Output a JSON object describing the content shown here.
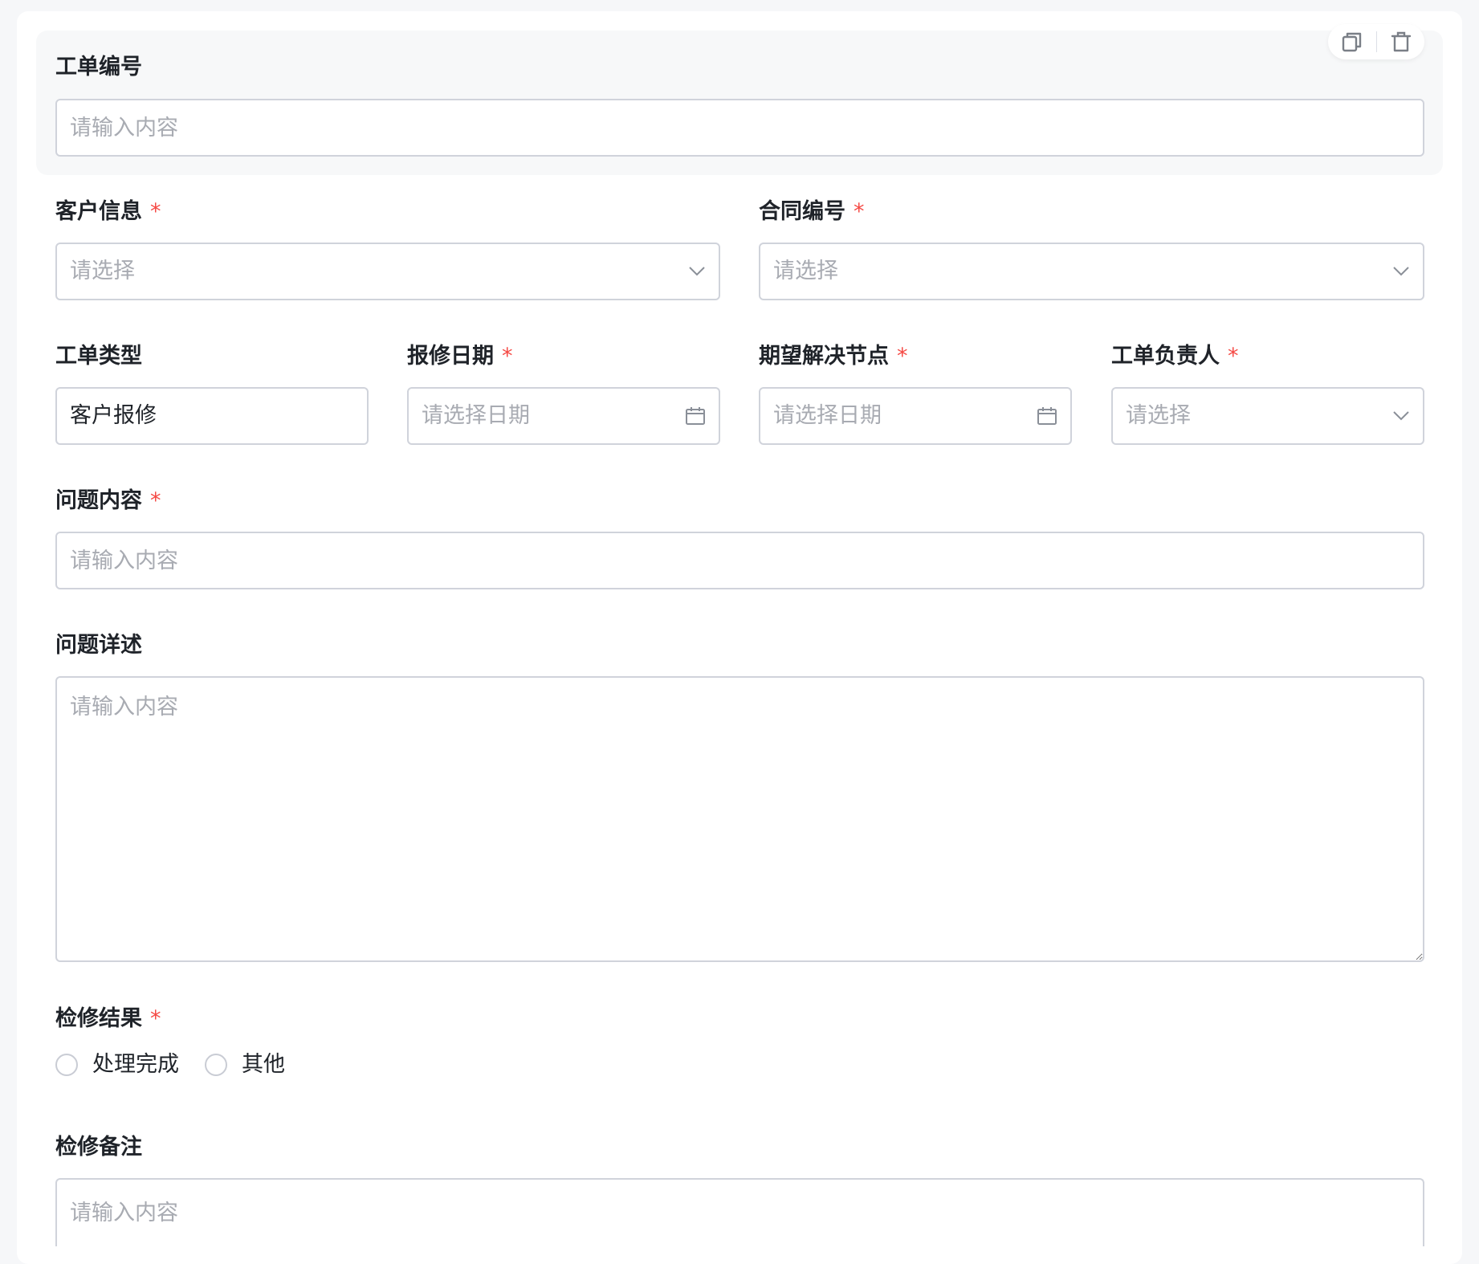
{
  "form": {
    "work_order_no": {
      "label": "工单编号",
      "placeholder": "请输入内容"
    },
    "customer_info": {
      "label": "客户信息",
      "required_mark": "*",
      "placeholder": "请选择",
      "icon": "chevron-down-icon"
    },
    "contract_no": {
      "label": "合同编号",
      "required_mark": "*",
      "placeholder": "请选择",
      "icon": "chevron-down-icon"
    },
    "work_order_type": {
      "label": "工单类型",
      "value": "客户报修"
    },
    "report_date": {
      "label": "报修日期",
      "required_mark": "*",
      "placeholder": "请选择日期",
      "icon": "calendar-icon"
    },
    "expected_resolution": {
      "label": "期望解决节点",
      "required_mark": "*",
      "placeholder": "请选择日期",
      "icon": "calendar-icon"
    },
    "owner": {
      "label": "工单负责人",
      "required_mark": "*",
      "placeholder": "请选择",
      "icon": "chevron-down-icon"
    },
    "issue_content": {
      "label": "问题内容",
      "required_mark": "*",
      "placeholder": "请输入内容"
    },
    "issue_detail": {
      "label": "问题详述",
      "placeholder": "请输入内容"
    },
    "repair_result": {
      "label": "检修结果",
      "required_mark": "*",
      "options": [
        {
          "label": "处理完成",
          "checked": false
        },
        {
          "label": "其他",
          "checked": false
        }
      ]
    },
    "repair_note": {
      "label": "检修备注",
      "placeholder": "请输入内容"
    }
  },
  "block_actions": {
    "copy_icon": "copy-icon",
    "delete_icon": "trash-icon"
  },
  "colors": {
    "required": "#f54a45",
    "border": "#d0d3db",
    "placeholder": "#a8abb2",
    "block_bg": "#f7f8f9",
    "page_bg": "#f6f7f9"
  }
}
